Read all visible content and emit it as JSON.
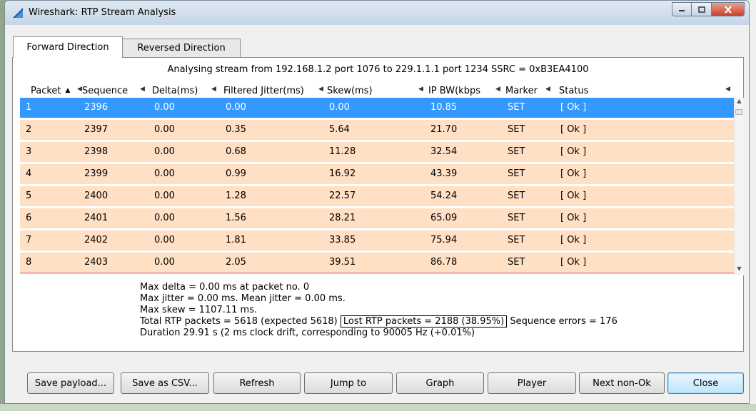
{
  "window": {
    "title": "Wireshark: RTP Stream Analysis"
  },
  "tabs": [
    {
      "label": "Forward Direction",
      "active": true
    },
    {
      "label": "Reversed Direction",
      "active": false
    }
  ],
  "analysing_text": "Analysing stream from  192.168.1.2 port 1076  to  229.1.1.1 port 1234   SSRC = 0xB3EA4100",
  "table": {
    "columns": [
      "Packet",
      "Sequence",
      "Delta(ms)",
      "Filtered Jitter(ms)",
      "Skew(ms)",
      "IP BW(kbps",
      "Marker",
      "Status"
    ],
    "rows": [
      [
        "1",
        "2396",
        "0.00",
        "0.00",
        "0.00",
        "10.85",
        "SET",
        "[ Ok ]"
      ],
      [
        "2",
        "2397",
        "0.00",
        "0.35",
        "5.64",
        "21.70",
        "SET",
        "[ Ok ]"
      ],
      [
        "3",
        "2398",
        "0.00",
        "0.68",
        "11.28",
        "32.54",
        "SET",
        "[ Ok ]"
      ],
      [
        "4",
        "2399",
        "0.00",
        "0.99",
        "16.92",
        "43.39",
        "SET",
        "[ Ok ]"
      ],
      [
        "5",
        "2400",
        "0.00",
        "1.28",
        "22.57",
        "54.24",
        "SET",
        "[ Ok ]"
      ],
      [
        "6",
        "2401",
        "0.00",
        "1.56",
        "28.21",
        "65.09",
        "SET",
        "[ Ok ]"
      ],
      [
        "7",
        "2402",
        "0.00",
        "1.81",
        "33.85",
        "75.94",
        "SET",
        "[ Ok ]"
      ],
      [
        "8",
        "2403",
        "0.00",
        "2.05",
        "39.51",
        "86.78",
        "SET",
        "[ Ok ]"
      ]
    ]
  },
  "stats": {
    "max_delta": "Max delta = 0.00 ms at packet no. 0",
    "max_jitter": "Max jitter = 0.00 ms. Mean jitter = 0.00 ms.",
    "max_skew": "Max skew = 1107.11 ms.",
    "total": "Total RTP packets = 5618   (expected 5618)",
    "lost": "Lost RTP packets = 2188 (38.95%)",
    "seq_errors": "Sequence errors = 176",
    "duration": "Duration 29.91 s (2 ms clock drift, corresponding to 90005 Hz (+0.01%)"
  },
  "buttons": {
    "save_payload": "Save payload...",
    "save_csv": "Save as CSV...",
    "refresh": "Refresh",
    "jump_to": "Jump to",
    "graph": "Graph",
    "player": "Player",
    "next_non_ok": "Next non-Ok",
    "close": "Close"
  },
  "colors": {
    "row_bg": "#ffe0c4",
    "selected_bg": "#3399ff",
    "close_btn": "#c7402c"
  }
}
